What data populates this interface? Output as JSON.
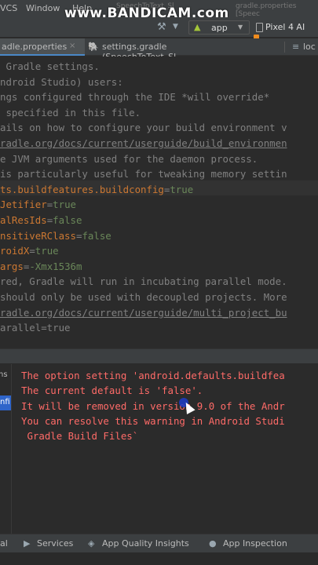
{
  "watermark": "www.BANDICAM.com",
  "menubar": {
    "items": [
      "VCS",
      "Window",
      "Help"
    ],
    "title_fragment_1": "SpeechToText_Sl",
    "title_fragment_2": "gradle.properties [Speec"
  },
  "toolbar": {
    "run_config": "app",
    "device": "Pixel 4 AI"
  },
  "logo": {
    "tech": "tech",
    "digit": "digit-z"
  },
  "tabs": [
    {
      "label": "adle.properties",
      "active": true,
      "close": "×"
    },
    {
      "label": "settings.gradle (SpeechToText_Sl"
    },
    {
      "label": "loc"
    }
  ],
  "editor": {
    "lines": [
      {
        "text": " Gradle settings.",
        "type": "comment"
      },
      {
        "text": "ndroid Studio) users:",
        "type": "comment"
      },
      {
        "text": "ngs configured through the IDE *will override*",
        "type": "comment"
      },
      {
        "text": " specified in this file.",
        "type": "comment"
      },
      {
        "text": "ails on how to configure your build environment v",
        "type": "comment"
      },
      {
        "text": "radle.org/docs/current/userguide/build_environmen",
        "type": "link"
      },
      {
        "text": "e JVM arguments used for the daemon process.",
        "type": "comment"
      },
      {
        "text": "is particularly useful for tweaking memory settin",
        "type": "comment"
      },
      {
        "key": "ts.buildfeatures.buildconfig",
        "value": "true",
        "type": "prop"
      },
      {
        "key": "Jetifier",
        "value": "true",
        "type": "prop"
      },
      {
        "key": "alResIds",
        "value": "false",
        "type": "prop"
      },
      {
        "key": "nsitiveRClass",
        "value": "false",
        "type": "prop"
      },
      {
        "key": "roidX",
        "value": "true",
        "type": "prop"
      },
      {
        "key": "args",
        "value": "-Xmx1536m",
        "type": "prop"
      },
      {
        "text": "red, Gradle will run in incubating parallel mode.",
        "type": "comment"
      },
      {
        "text": "should only be used with decoupled projects. More",
        "type": "comment"
      },
      {
        "text": "radle.org/docs/current/userguide/multi_project_bu",
        "type": "link"
      },
      {
        "text": "arallel=true",
        "type": "comment"
      }
    ]
  },
  "build_panel": {
    "tree_item_1": "ns",
    "tree_item_2": "nfi",
    "messages": [
      "The option setting 'android.defaults.buildfea",
      "The current default is 'false'.",
      "It will be removed in version 9.0 of the Andr",
      "You can resolve this warning in Android Studi",
      " Gradle Build Files`"
    ]
  },
  "bottom_bar": {
    "items": [
      "al",
      "Services",
      "App Quality Insights",
      "App Inspection"
    ]
  },
  "colors": {
    "editor_bg": "#2b2b2b",
    "chrome_bg": "#3c3f41",
    "comment": "#808080",
    "keyword": "#cc7832",
    "string": "#6a8759",
    "error": "#ff6b68",
    "selection": "#2f65ca"
  }
}
